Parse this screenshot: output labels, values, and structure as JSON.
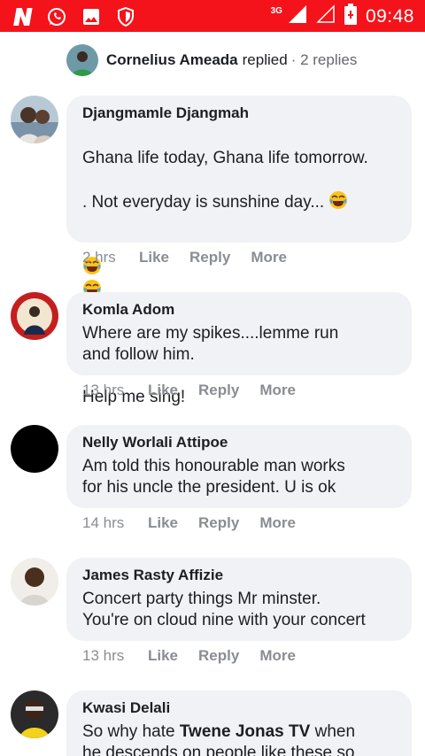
{
  "status_bar": {
    "network": "3G",
    "time": "09:48",
    "icons": [
      "news-app-icon",
      "whatsapp-icon",
      "gallery-icon",
      "shield-icon"
    ]
  },
  "replied": {
    "name": "Cornelius Ameada",
    "verb": "replied",
    "count": "· 2 replies"
  },
  "comments": [
    {
      "author": "Djangmamle Djangmah",
      "line1": "Ghana life today, Ghana life tomorrow.",
      "line2": ". Not everyday is sunshine day...",
      "line3": "Help me sing!",
      "time": "2 hrs",
      "like": "Like",
      "reply": "Reply",
      "more": "More"
    },
    {
      "author": "Komla Adom",
      "text": "Where are my spikes....lemme run\nand follow him.",
      "time": "13 hrs",
      "like": "Like",
      "reply": "Reply",
      "more": "More"
    },
    {
      "author": "Nelly Worlali Attipoe",
      "text": "Am told this honourable man works\nfor his uncle the president. U is ok",
      "time": "14 hrs",
      "like": "Like",
      "reply": "Reply",
      "more": "More"
    },
    {
      "author": "James Rasty Affizie",
      "text": "Concert party things Mr minster.\nYou're on cloud nine with your concert",
      "time": "13 hrs",
      "like": "Like",
      "reply": "Reply",
      "more": "More"
    },
    {
      "author": "Kwasi Delali",
      "text_pre": "So why hate ",
      "text_bold": "Twene Jonas TV",
      "text_post": " when",
      "text_line2": "he descends on people like these so"
    }
  ]
}
